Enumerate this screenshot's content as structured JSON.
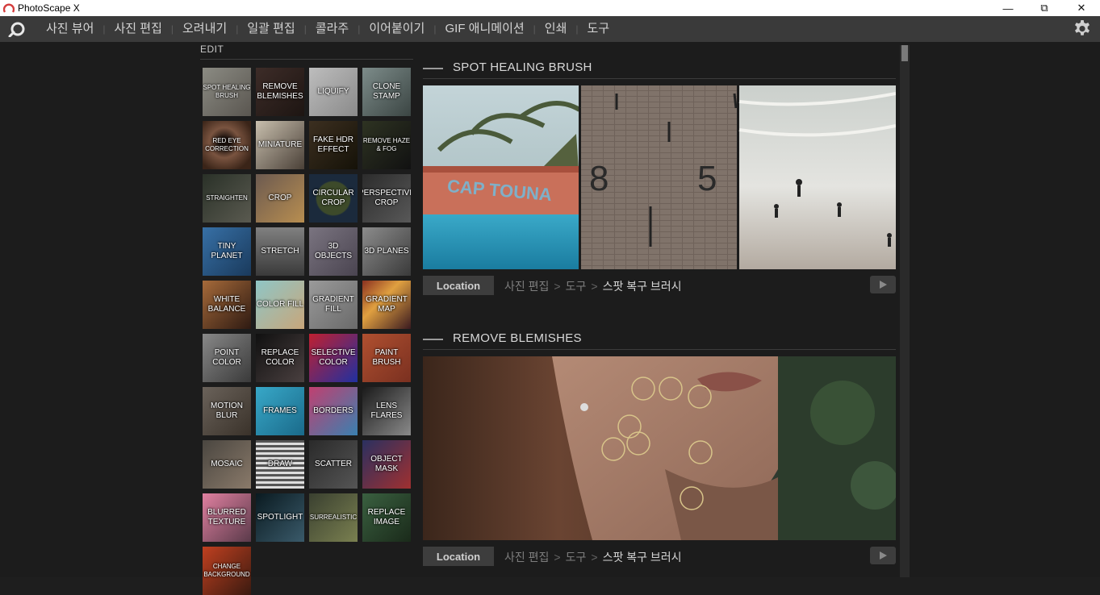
{
  "window": {
    "title": "PhotoScape X",
    "minimize": "—",
    "maximize": "⧉",
    "close": "✕"
  },
  "menu": [
    "사진 뷰어",
    "사진 편집",
    "오려내기",
    "일괄 편집",
    "콜라주",
    "이어붙이기",
    "GIF 애니메이션",
    "인쇄",
    "도구"
  ],
  "edit_label": "EDIT",
  "tools": [
    [
      "SPOT HEALING BRUSH",
      "REMOVE BLEMISHES",
      "LIQUIFY",
      "CLONE STAMP"
    ],
    [
      "RED EYE CORRECTION",
      "MINIATURE",
      "FAKE HDR EFFECT",
      "REMOVE HAZE & FOG"
    ],
    [
      "STRAIGHTEN",
      "CROP",
      "CIRCULAR CROP",
      "PERSPECTIVE CROP"
    ],
    [
      "TINY PLANET",
      "STRETCH",
      "3D OBJECTS",
      "3D PLANES"
    ],
    [
      "WHITE BALANCE",
      "COLOR FILL",
      "GRADIENT FILL",
      "GRADIENT MAP"
    ],
    [
      "POINT COLOR",
      "REPLACE COLOR",
      "SELECTIVE COLOR",
      "PAINT BRUSH"
    ],
    [
      "MOTION BLUR",
      "FRAMES",
      "BORDERS",
      "LENS FLARES"
    ],
    [
      "MOSAIC",
      "DRAW",
      "SCATTER",
      "OBJECT MASK"
    ],
    [
      "BLURRED TEXTURE",
      "SPOTLIGHT",
      "SURREALISTIC",
      "REPLACE IMAGE"
    ],
    [
      "CHANGE BACKGROUND"
    ]
  ],
  "sections": [
    {
      "title": "SPOT HEALING BRUSH",
      "location_label": "Location",
      "path": [
        "사진 편집",
        "도구",
        "스팟 복구 브러시"
      ],
      "boat_text": "CAP TOUNA",
      "wall_numbers": [
        "8",
        "5"
      ]
    },
    {
      "title": "REMOVE BLEMISHES",
      "location_label": "Location",
      "path": [
        "사진 편집",
        "도구",
        "스팟 복구 브러시"
      ]
    }
  ],
  "icons": {
    "logo": "photoscape-logo-icon",
    "gear": "gear-icon",
    "play": "play-icon"
  },
  "colors": {
    "menubar": "#3a3a3a",
    "background": "#1c1c1c",
    "location_button": "#3d3d3d"
  }
}
